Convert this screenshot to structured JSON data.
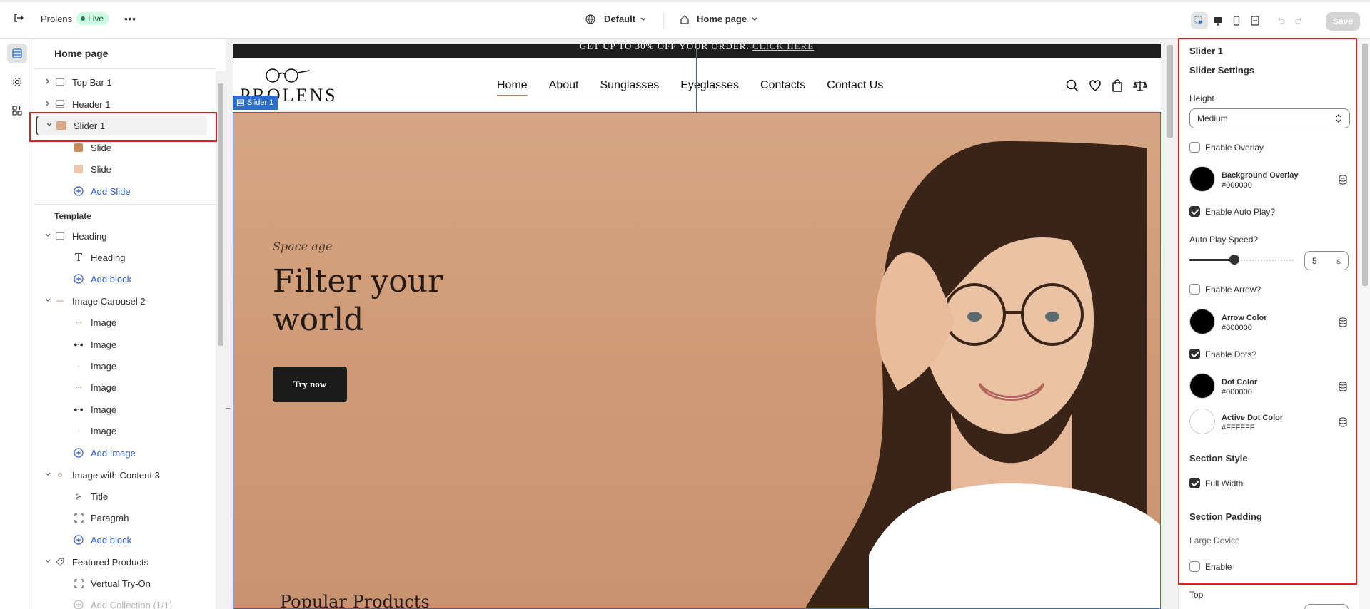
{
  "topbar": {
    "store_name": "Prolens",
    "status_badge": "Live",
    "theme_selector": "Default",
    "page_selector": "Home page",
    "save_label": "Save"
  },
  "tree": {
    "title": "Home page",
    "items": [
      {
        "label": "Top Bar 1"
      },
      {
        "label": "Header 1"
      },
      {
        "label": "Slider 1"
      },
      {
        "label": "Slide"
      },
      {
        "label": "Slide"
      },
      {
        "label": "Add Slide"
      }
    ],
    "template_heading": "Template",
    "template_items": [
      {
        "label": "Heading"
      },
      {
        "label": "Heading"
      },
      {
        "label": "Add block"
      },
      {
        "label": "Image Carousel 2"
      },
      {
        "label": "Image"
      },
      {
        "label": "Image"
      },
      {
        "label": "Image"
      },
      {
        "label": "Image"
      },
      {
        "label": "Image"
      },
      {
        "label": "Image"
      },
      {
        "label": "Add Image"
      },
      {
        "label": "Image with Content 3"
      },
      {
        "label": "Title"
      },
      {
        "label": "Paragrah"
      },
      {
        "label": "Add block"
      },
      {
        "label": "Featured Products"
      },
      {
        "label": "Vertual Try-On"
      },
      {
        "label": "Add Collection (1/1)"
      }
    ]
  },
  "preview": {
    "promo": "GET UP TO 30% OFF YOUR ORDER.",
    "promo_link": "CLICK HERE",
    "logo": "PROLENS",
    "nav": [
      "Home",
      "About",
      "Sunglasses",
      "Eyeglasses",
      "Contacts",
      "Contact Us"
    ],
    "slider_badge": "Slider 1",
    "hero_small": "Space age",
    "hero_title_1": "Filter your",
    "hero_title_2": "world",
    "hero_button": "Try now",
    "next_section": "Popular Products"
  },
  "settings": {
    "title": "Slider 1",
    "subtitle": "Slider Settings",
    "height_label": "Height",
    "height_value": "Medium",
    "enable_overlay": "Enable Overlay",
    "bg_overlay_name": "Background Overlay",
    "bg_overlay_value": "#000000",
    "enable_autoplay": "Enable Auto Play?",
    "autoplay_speed_label": "Auto Play Speed?",
    "autoplay_speed_value": "5",
    "autoplay_speed_unit": "s",
    "enable_arrow": "Enable Arrow?",
    "arrow_color_name": "Arrow Color",
    "arrow_color_value": "#000000",
    "enable_dots": "Enable Dots?",
    "dot_color_name": "Dot Color",
    "dot_color_value": "#000000",
    "active_dot_name": "Active Dot Color",
    "active_dot_value": "#FFFFFF",
    "section_style": "Section Style",
    "full_width": "Full Width",
    "section_padding": "Section Padding",
    "large_device": "Large Device",
    "enable": "Enable",
    "top": "Top"
  },
  "colors": {
    "accent": "#2c6ecb",
    "highlight": "#e01e1e",
    "link": "#2c5acb"
  }
}
